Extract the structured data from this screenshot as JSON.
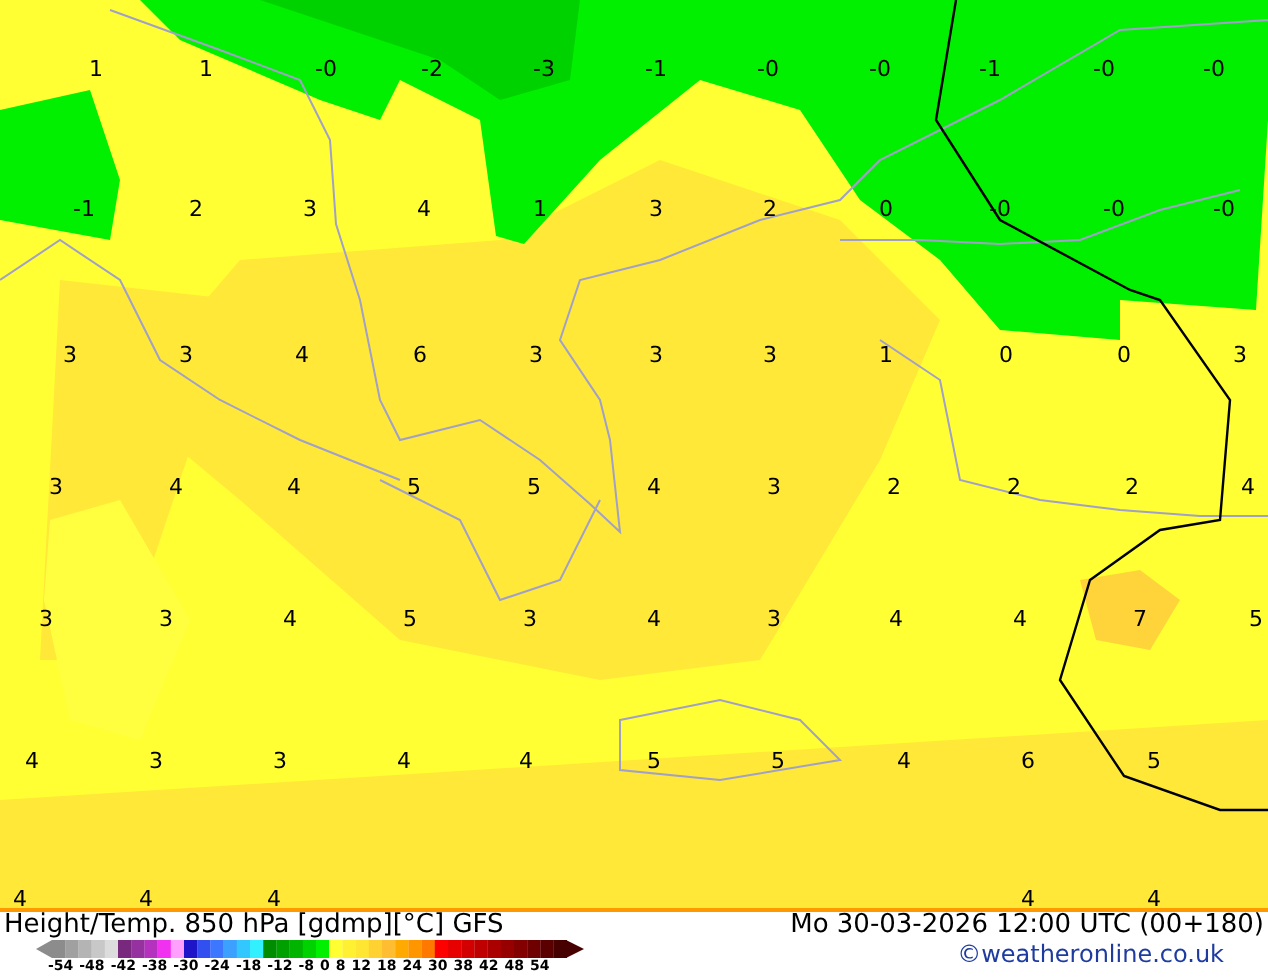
{
  "map": {
    "label_rows": [
      [
        "1",
        "1",
        "-0",
        "-2",
        "-3",
        "-1",
        "-0",
        "-0",
        "-1",
        "-0",
        "-0"
      ],
      [
        "-1",
        "2",
        "3",
        "4",
        "1",
        "3",
        "2",
        "0",
        "-0",
        "-0",
        "-0"
      ],
      [
        "3",
        "3",
        "4",
        "6",
        "3",
        "3",
        "3",
        "1",
        "0",
        "0",
        "3"
      ],
      [
        "3",
        "4",
        "4",
        "5",
        "5",
        "4",
        "3",
        "2",
        "2",
        "2",
        "4"
      ],
      [
        "3",
        "3",
        "4",
        "5",
        "3",
        "4",
        "3",
        "4",
        "4",
        "7",
        "5"
      ],
      [
        "4",
        "3",
        "3",
        "4",
        "4",
        "5",
        "5",
        "4",
        "6",
        "5"
      ],
      [
        "4",
        "4",
        "4",
        "4",
        "4"
      ]
    ]
  },
  "footer": {
    "title": "Height/Temp. 850 hPa [gdmp][°C] GFS",
    "datetime": "Mo 30-03-2026 12:00 UTC (00+180)",
    "credit": "©weatheronline.co.uk",
    "legend_ticks": [
      "-54",
      "-48",
      "-42",
      "-38",
      "-30",
      "-24",
      "-18",
      "-12",
      "-8",
      "0",
      "8",
      "12",
      "18",
      "24",
      "30",
      "38",
      "42",
      "48",
      "54"
    ]
  }
}
